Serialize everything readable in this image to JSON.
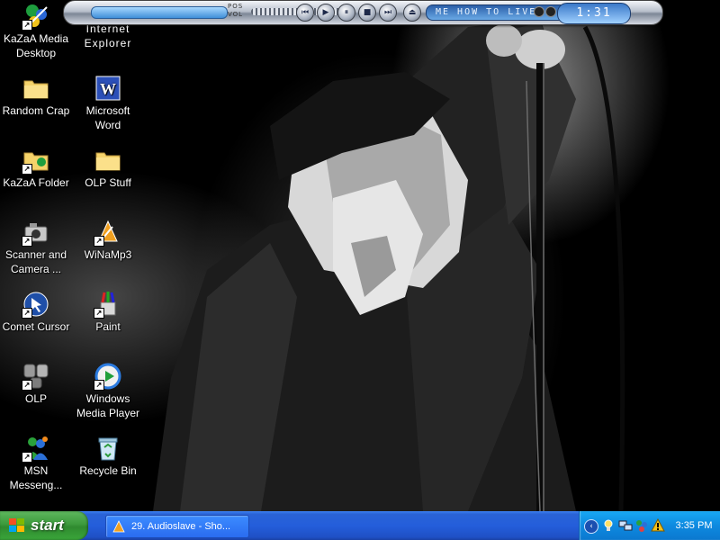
{
  "desktop": {
    "icons": [
      {
        "label": "KaZaA Media Desktop"
      },
      {
        "label": "Internet Explorer"
      },
      {
        "label": "Random Crap"
      },
      {
        "label": "Microsoft Word"
      },
      {
        "label": "KaZaA Folder"
      },
      {
        "label": "OLP Stuff"
      },
      {
        "label": "Scanner and Camera ..."
      },
      {
        "label": "WiNaMp3"
      },
      {
        "label": "Comet Cursor"
      },
      {
        "label": "Paint"
      },
      {
        "label": "OLP"
      },
      {
        "label": "Windows Media Player"
      },
      {
        "label": "MSN Messeng..."
      },
      {
        "label": "Recycle Bin"
      }
    ]
  },
  "player": {
    "pos_label": "POS",
    "vol_label": "VOL",
    "track_title": "ME HOW TO LIVE",
    "time": "1:31",
    "buttons": [
      "previous",
      "play",
      "pause",
      "stop",
      "next",
      "eject"
    ]
  },
  "taskbar": {
    "start_label": "start",
    "task_label": "29. Audioslave - Sho...",
    "clock": "3:35 PM",
    "tray_chevron": "‹"
  },
  "colors": {
    "taskbar_blue": "#245edb",
    "start_green": "#3c9a3c",
    "tray_blue": "#0e8ae0"
  }
}
